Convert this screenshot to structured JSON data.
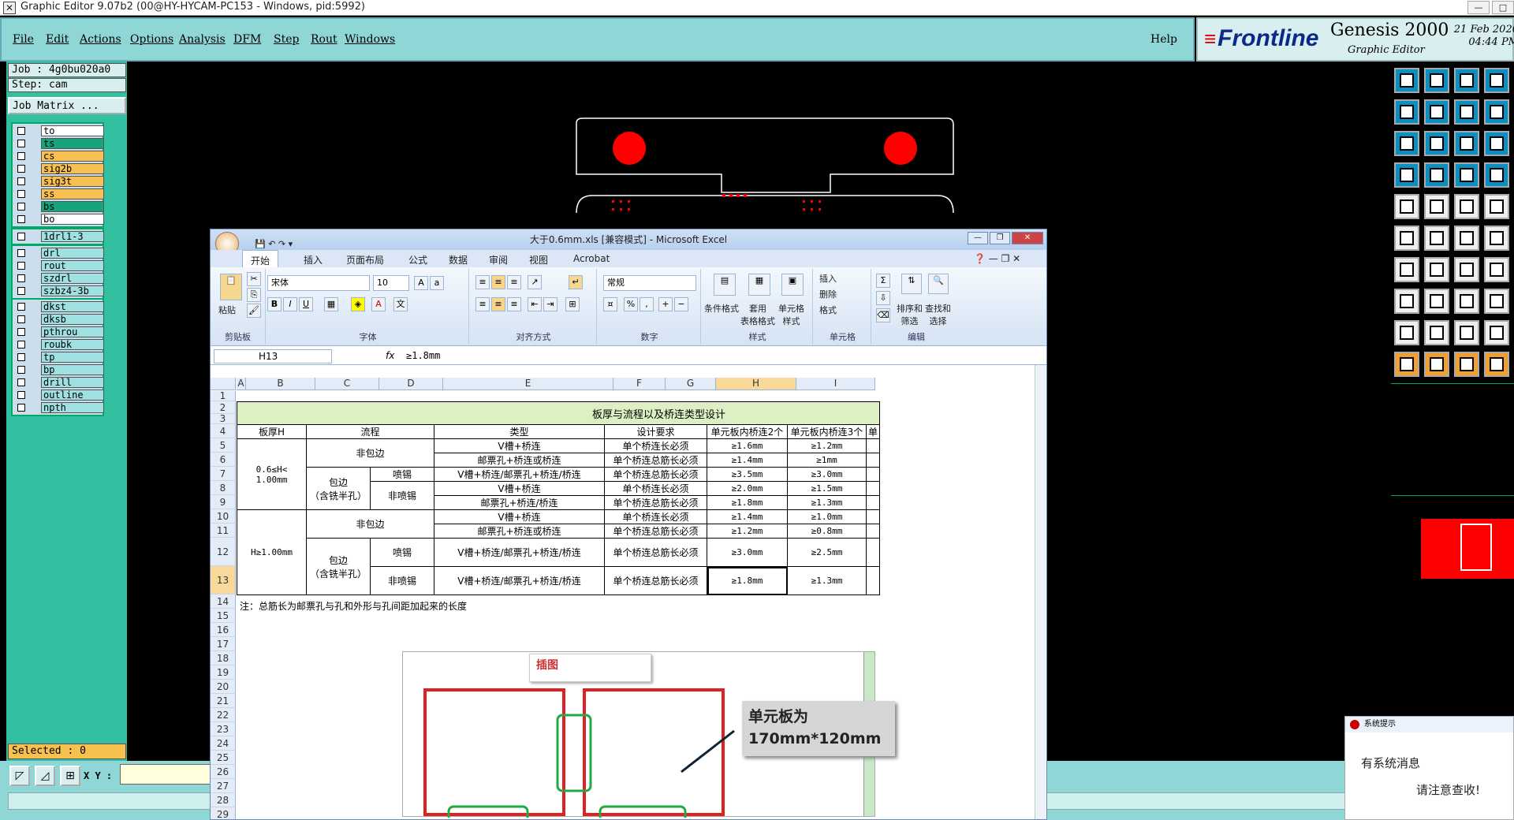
{
  "title_bar": {
    "text": "Graphic Editor 9.07b2 (00@HY-HYCAM-PC153 - Windows, pid:5992)"
  },
  "menu": {
    "items": [
      "File",
      "Edit",
      "Actions",
      "Options",
      "Analysis",
      "DFM",
      "Step",
      "Rout",
      "Windows"
    ],
    "help": "Help"
  },
  "brand": {
    "logo": "Frontline",
    "product": "Genesis 2000",
    "subtitle": "Graphic Editor",
    "date": "21 Feb 2020",
    "time": "04:44 PM"
  },
  "job": {
    "job_label": "Job : 4g0bu020a0",
    "step_label": "Step: cam",
    "matrix_button": "Job Matrix ..."
  },
  "layers": {
    "group1": [
      {
        "name": "to",
        "color": "#ffffff"
      },
      {
        "name": "ts",
        "color": "#1aa37a"
      },
      {
        "name": "cs",
        "color": "#f8c050"
      },
      {
        "name": "sig2b",
        "color": "#f8c050"
      },
      {
        "name": "sig3t",
        "color": "#f8c050"
      },
      {
        "name": "ss",
        "color": "#f8c050"
      },
      {
        "name": "bs",
        "color": "#1aa37a"
      },
      {
        "name": "bo",
        "color": "#ffffff"
      }
    ],
    "group2": [
      {
        "name": "1drl1-3",
        "color": "#9fe0e0"
      }
    ],
    "group3": [
      {
        "name": "drl",
        "color": "#9fe0e0"
      },
      {
        "name": "rout",
        "color": "#9fe0e0"
      },
      {
        "name": "szdrl",
        "color": "#9fe0e0"
      },
      {
        "name": "szbz4-3b",
        "color": "#9fe0e0"
      }
    ],
    "group4": [
      {
        "name": "dkst",
        "color": "#9fe0e0"
      },
      {
        "name": "dksb",
        "color": "#9fe0e0"
      },
      {
        "name": "pthrou",
        "color": "#9fe0e0"
      },
      {
        "name": "roubk",
        "color": "#9fe0e0"
      },
      {
        "name": "tp",
        "color": "#9fe0e0"
      },
      {
        "name": "bp",
        "color": "#9fe0e0"
      },
      {
        "name": "drill",
        "color": "#9fe0e0"
      },
      {
        "name": "outline",
        "color": "#9fe0e0"
      },
      {
        "name": "npth",
        "color": "#9fe0e0"
      }
    ]
  },
  "status": {
    "selected": "Selected : 0",
    "xy_label": "X Y :"
  },
  "sysmsg": {
    "title": "系统提示",
    "line1": "有系统消息",
    "line2": "请注意查收!"
  },
  "excel": {
    "window_title": "大于0.6mm.xls  [兼容模式] - Microsoft Excel",
    "tabs": [
      "开始",
      "插入",
      "页面布局",
      "公式",
      "数据",
      "审阅",
      "视图",
      "Acrobat"
    ],
    "font_name": "宋体",
    "font_size": "10",
    "number_format": "常规",
    "groups": [
      "剪贴板",
      "字体",
      "对齐方式",
      "数字",
      "样式",
      "单元格",
      "编辑"
    ],
    "ribbon_buttons": {
      "paste": "粘贴",
      "cond": "条件格式",
      "table": "套用\n表格格式",
      "cellstyle": "单元格\n样式",
      "insert": "插入",
      "delete": "删除",
      "format": "格式",
      "sort": "排序和\n筛选",
      "find": "查找和\n选择"
    },
    "name_box": "H13",
    "formula": "≥1.8mm",
    "columns": [
      "A",
      "B",
      "C",
      "D",
      "E",
      "F",
      "G",
      "H",
      "I"
    ],
    "rows": [
      "1",
      "2",
      "3",
      "4",
      "5",
      "6",
      "7",
      "8",
      "9",
      "10",
      "11",
      "12",
      "13",
      "14",
      "15",
      "16",
      "17",
      "18",
      "19",
      "20",
      "21",
      "22",
      "23",
      "24",
      "25",
      "26",
      "27",
      "28",
      "29"
    ],
    "table_title": "板厚与流程以及桥连类型设计",
    "headers": [
      "板厚H",
      "流程",
      "类型",
      "设计要求",
      "单元板内桥连2个",
      "单元板内桥连3个",
      "单"
    ],
    "thick1": "0.6≤H<\n1.00mm",
    "thick2": "H≥1.00mm",
    "feibaobian": "非包边",
    "baobian": "包边\n（含铣半孔）",
    "pentin": "喷锡",
    "feipentin": "非喷锡",
    "data_rows": [
      [
        "V槽+桥连",
        "单个桥连长必须",
        "≥1.6mm",
        "≥1.2mm"
      ],
      [
        "邮票孔+桥连或桥连",
        "单个桥连总筋长必须",
        "≥1.4mm",
        "≥1mm"
      ],
      [
        "V槽+桥连/邮票孔+桥连/桥连",
        "单个桥连总筋长必须",
        "≥3.5mm",
        "≥3.0mm"
      ],
      [
        "V槽+桥连",
        "单个桥连长必须",
        "≥2.0mm",
        "≥1.5mm"
      ],
      [
        "邮票孔+桥连/桥连",
        "单个桥连总筋长必须",
        "≥1.8mm",
        "≥1.3mm"
      ],
      [
        "V槽+桥连",
        "单个桥连长必须",
        "≥1.4mm",
        "≥1.0mm"
      ],
      [
        "邮票孔+桥连或桥连",
        "单个桥连总筋长必须",
        "≥1.2mm",
        "≥0.8mm"
      ],
      [
        "V槽+桥连/邮票孔+桥连/桥连",
        "单个桥连总筋长必须",
        "≥3.0mm",
        "≥2.5mm"
      ],
      [
        "V槽+桥连/邮票孔+桥连/桥连",
        "单个桥连总筋长必须",
        "≥1.8mm",
        "≥1.3mm"
      ]
    ],
    "note": "注：总筋长为邮票孔与孔和外形与孔间距加起来的长度",
    "figure_tag": "插图",
    "callout": "单元板为\n170mm*120mm"
  }
}
